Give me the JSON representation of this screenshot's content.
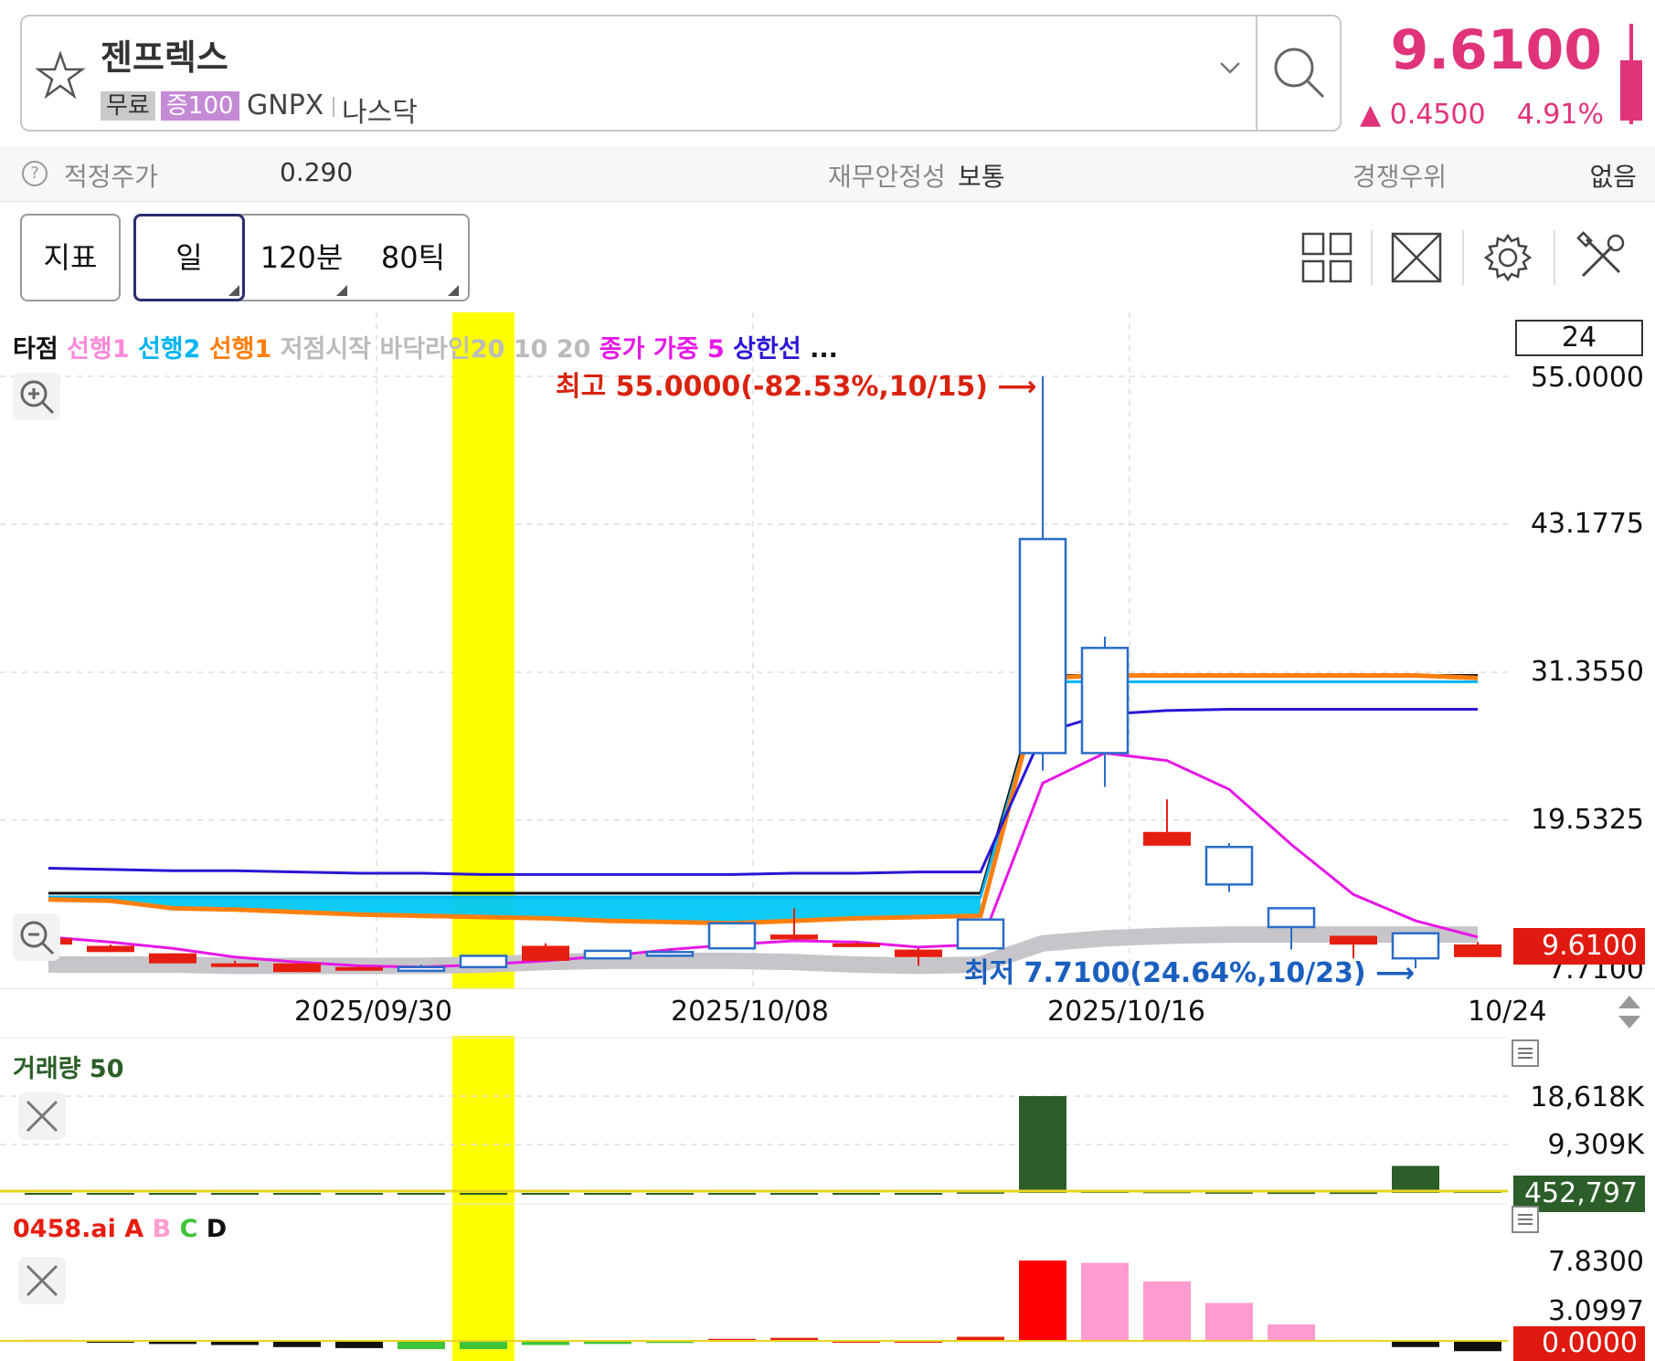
{
  "header": {
    "stock_name": "젠프렉스",
    "tag_free": "무료",
    "tag_margin": "증100",
    "ticker": "GNPX",
    "market": "나스닥",
    "price": "9.6100",
    "change": "▲ 0.4500",
    "change_pct": "4.91%"
  },
  "info": {
    "fair_price_label": "적정주가",
    "fair_price_value": "0.290",
    "stability_label": "재무안정성",
    "stability_value": "보통",
    "competitive_label": "경쟁우위",
    "competitive_value": "없음"
  },
  "toolbar": {
    "indicator_label": "지표",
    "day_label": "일",
    "min120_label": "120분",
    "tick80_label": "80틱"
  },
  "chart": {
    "legend": [
      {
        "text": "타점",
        "color": "#111111"
      },
      {
        "text": "선행1",
        "color": "#ff8ad8"
      },
      {
        "text": "선행2",
        "color": "#00b4f0"
      },
      {
        "text": "선행1",
        "color": "#ff7f0e"
      },
      {
        "text": "저점시작",
        "color": "#bbbbbb"
      },
      {
        "text": "바닥라인20",
        "color": "#bbbbbb"
      },
      {
        "text": "10",
        "color": "#bbbbbb"
      },
      {
        "text": "20",
        "color": "#bbbbbb"
      },
      {
        "text": "종가 가중 5",
        "color": "#e617e6"
      },
      {
        "text": "상한선",
        "color": "#2a16d6"
      },
      {
        "text": "...",
        "color": "#111111"
      }
    ],
    "period": "24",
    "high_annotation": "최고 55.0000(-82.53%,10/15) ⟶",
    "low_annotation": "최저 7.7100(24.64%,10/23) ⟶",
    "current_price_tag": "9.6100",
    "colors": {
      "up": "#e61e10",
      "down": "#2a6cc8",
      "highlight": "#ffff00"
    }
  },
  "chart_data": [
    {
      "type": "candlestick",
      "y_ticks": [
        "55.0000",
        "43.1775",
        "31.3550",
        "19.5325",
        "7.7100"
      ],
      "ylim": [
        7.71,
        55.0
      ],
      "x_tick_labels": [
        "2025/09/30",
        "2025/10/08",
        "2025/10/16",
        "10/24"
      ],
      "candles": [
        {
          "o": 10.1,
          "h": 10.2,
          "l": 9.6,
          "c": 9.6
        },
        {
          "o": 9.5,
          "h": 9.6,
          "l": 9.0,
          "c": 9.0
        },
        {
          "o": 8.9,
          "h": 8.9,
          "l": 8.1,
          "c": 8.1
        },
        {
          "o": 8.1,
          "h": 8.3,
          "l": 7.9,
          "c": 7.9
        },
        {
          "o": 8.1,
          "h": 8.1,
          "l": 7.4,
          "c": 7.4
        },
        {
          "o": 7.8,
          "h": 7.9,
          "l": 7.6,
          "c": 7.7
        },
        {
          "o": 7.7,
          "h": 8.0,
          "l": 7.6,
          "c": 7.8
        },
        {
          "o": 7.8,
          "h": 8.7,
          "l": 7.7,
          "c": 8.7
        },
        {
          "o": 9.5,
          "h": 9.7,
          "l": 8.3,
          "c": 8.3
        },
        {
          "o": 8.5,
          "h": 9.2,
          "l": 8.5,
          "c": 9.1
        },
        {
          "o": 9.0,
          "h": 9.2,
          "l": 8.6,
          "c": 9.0
        },
        {
          "o": 9.3,
          "h": 11.3,
          "l": 9.3,
          "c": 11.3
        },
        {
          "o": 10.4,
          "h": 12.5,
          "l": 10.0,
          "c": 10.0
        },
        {
          "o": 9.7,
          "h": 9.8,
          "l": 9.4,
          "c": 9.4
        },
        {
          "o": 9.2,
          "h": 9.3,
          "l": 7.9,
          "c": 8.6
        },
        {
          "o": 9.3,
          "h": 11.6,
          "l": 9.3,
          "c": 11.6
        },
        {
          "o": 24.9,
          "h": 55.0,
          "l": 23.5,
          "c": 42.0
        },
        {
          "o": 24.9,
          "h": 34.2,
          "l": 22.2,
          "c": 33.3
        },
        {
          "o": 18.6,
          "h": 21.2,
          "l": 17.5,
          "c": 17.5
        },
        {
          "o": 14.4,
          "h": 17.7,
          "l": 13.8,
          "c": 17.4
        },
        {
          "o": 11.0,
          "h": 12.5,
          "l": 9.2,
          "c": 12.5
        },
        {
          "o": 10.3,
          "h": 10.3,
          "l": 8.5,
          "c": 9.6
        },
        {
          "o": 8.5,
          "h": 10.6,
          "l": 7.71,
          "c": 10.5
        },
        {
          "o": 9.61,
          "h": 9.8,
          "l": 8.6,
          "c": 8.6
        }
      ],
      "series": [
        {
          "name": "종가 가중 5",
          "color": "#e617e6",
          "values": [
            10.2,
            9.8,
            9.3,
            8.6,
            8.2,
            7.9,
            7.8,
            8.0,
            8.3,
            8.7,
            9.2,
            9.6,
            9.9,
            9.8,
            9.4,
            9.6,
            22.5,
            24.9,
            24.3,
            22.0,
            17.6,
            13.6,
            11.5,
            10.2
          ]
        },
        {
          "name": "상한선",
          "color": "#2a16d6",
          "values": [
            15.7,
            15.6,
            15.5,
            15.5,
            15.4,
            15.3,
            15.3,
            15.2,
            15.2,
            15.2,
            15.2,
            15.2,
            15.3,
            15.3,
            15.4,
            15.4,
            26.5,
            28.0,
            28.3,
            28.4,
            28.4,
            28.4,
            28.4,
            28.4
          ]
        },
        {
          "name": "선행1",
          "color": "#ff7f0e",
          "values": [
            13.2,
            13.1,
            12.5,
            12.4,
            12.2,
            12.0,
            11.9,
            11.8,
            11.7,
            11.5,
            11.4,
            11.3,
            11.5,
            11.7,
            11.8,
            11.9,
            30.9,
            31.1,
            31.1,
            31.1,
            31.1,
            31.1,
            31.1,
            30.9
          ]
        },
        {
          "name": "선행2",
          "color": "#00b4f0",
          "values": [
            13.4,
            13.4,
            13.4,
            13.4,
            13.4,
            13.4,
            13.4,
            13.4,
            13.4,
            13.4,
            13.4,
            13.4,
            13.4,
            13.4,
            13.4,
            13.4,
            30.6,
            30.6,
            30.6,
            30.6,
            30.6,
            30.6,
            30.6,
            30.6
          ]
        },
        {
          "name": "바닥라인20",
          "color": "#c7c5c9",
          "values": [
            8.0,
            8.0,
            8.0,
            7.9,
            7.9,
            7.9,
            7.9,
            8.0,
            8.2,
            8.3,
            8.3,
            8.3,
            8.2,
            8.0,
            7.9,
            8.0,
            9.7,
            10.1,
            10.3,
            10.4,
            10.4,
            10.4,
            10.4,
            10.4
          ]
        }
      ]
    },
    {
      "type": "bar",
      "title": "거래량 50",
      "y_ticks": [
        "18,618K",
        "9,309K"
      ],
      "ylim": [
        0,
        18618
      ],
      "values": [
        0,
        0,
        0,
        0,
        0,
        0,
        0,
        0,
        0,
        0,
        0,
        0,
        0,
        0,
        0,
        200,
        18618,
        500,
        300,
        200,
        150,
        150,
        5200,
        452.8
      ],
      "last_value_tag": "452,797"
    },
    {
      "type": "bar",
      "title": "0458.ai",
      "legend": [
        {
          "text": "0458.ai",
          "color": "#e61e10"
        },
        {
          "text": "A",
          "color": "#e61e10"
        },
        {
          "text": "B",
          "color": "#ff9ccf"
        },
        {
          "text": "C",
          "color": "#3ec43a"
        },
        {
          "text": "D",
          "color": "#111111"
        }
      ],
      "y_ticks": [
        "7.8300",
        "3.0997"
      ],
      "values": [
        0.1,
        0.0,
        -0.3,
        -0.4,
        -0.6,
        -0.7,
        -0.8,
        -0.8,
        -0.4,
        -0.3,
        -0.2,
        0.2,
        0.3,
        0.0,
        0.0,
        0.4,
        7.83,
        7.6,
        5.8,
        3.7,
        1.6,
        0.1,
        -0.6,
        -1.0
      ],
      "bar_colors": [
        "#e61e10",
        "#111111",
        "#111111",
        "#111111",
        "#111111",
        "#111111",
        "#3ec43a",
        "#3ec43a",
        "#3ec43a",
        "#3ec43a",
        "#3ec43a",
        "#e61e10",
        "#e61e10",
        "#e61e10",
        "#e61e10",
        "#e61e10",
        "#ff0000",
        "#ff9ccf",
        "#ff9ccf",
        "#ff9ccf",
        "#ff9ccf",
        "#ff9ccf",
        "#111111",
        "#111111"
      ],
      "last_value_tag": "0.0000"
    }
  ]
}
